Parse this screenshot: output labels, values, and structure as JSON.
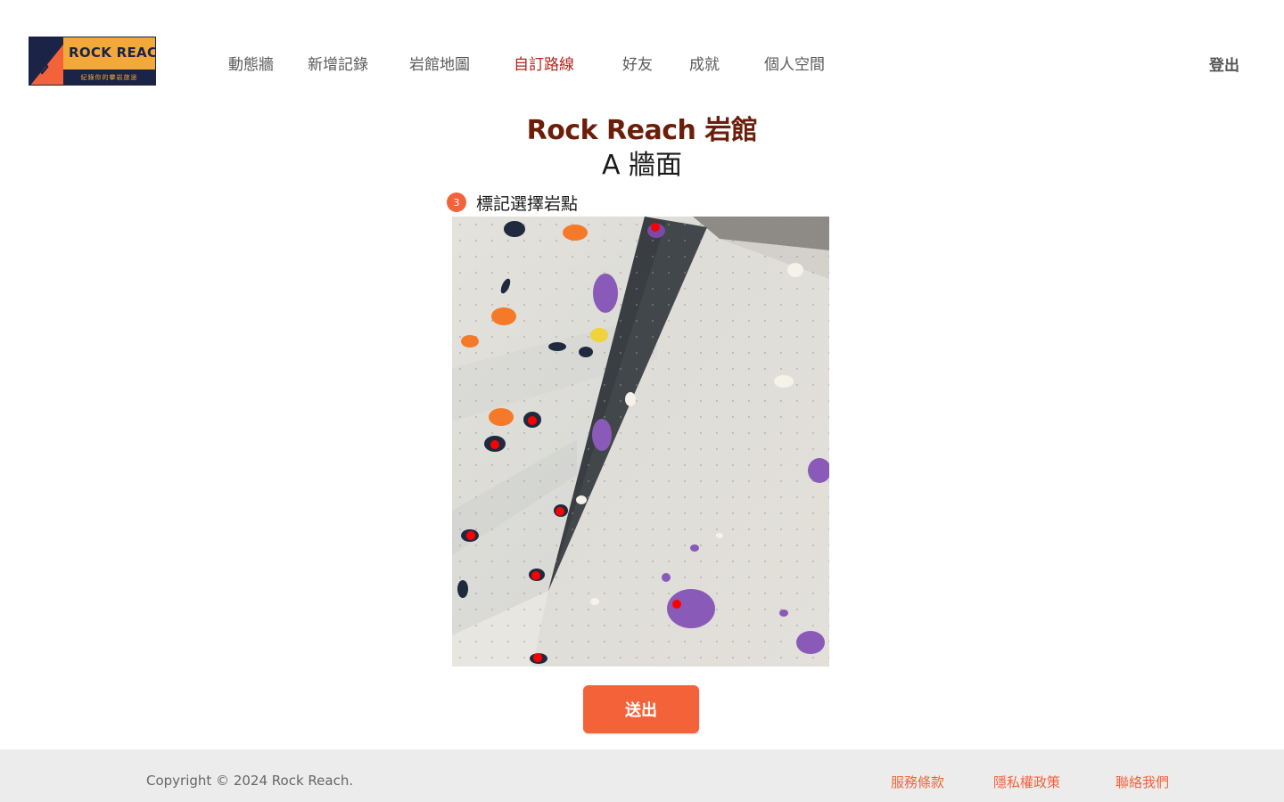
{
  "brand": {
    "name": "ROCK REACH",
    "tagline": "紀錄你的攀岩旅途",
    "colors": {
      "navy": "#1b2346",
      "gold": "#f3a93a",
      "accent": "#f4623a"
    }
  },
  "nav": {
    "items": [
      {
        "label": "動態牆",
        "active": false
      },
      {
        "label": "新增記錄",
        "active": false
      },
      {
        "label": "岩館地圖",
        "active": false
      },
      {
        "label": "自訂路線",
        "active": true
      },
      {
        "label": "好友",
        "active": false
      },
      {
        "label": "成就",
        "active": false
      },
      {
        "label": "個人空間",
        "active": false
      }
    ],
    "logout": "登出"
  },
  "main": {
    "gym_name": "Rock Reach 岩館",
    "wall_name": "A 牆面",
    "step": {
      "number": "3",
      "label": "標記選擇岩點"
    },
    "wall_image": {
      "icon": "climbing-wall-photo",
      "selected_hold_count": 11
    },
    "submit_label": "送出"
  },
  "footer": {
    "copyright": "Copyright © 2024 Rock Reach.",
    "links": [
      "服務條款",
      "隱私權政策",
      "聯絡我們"
    ]
  }
}
